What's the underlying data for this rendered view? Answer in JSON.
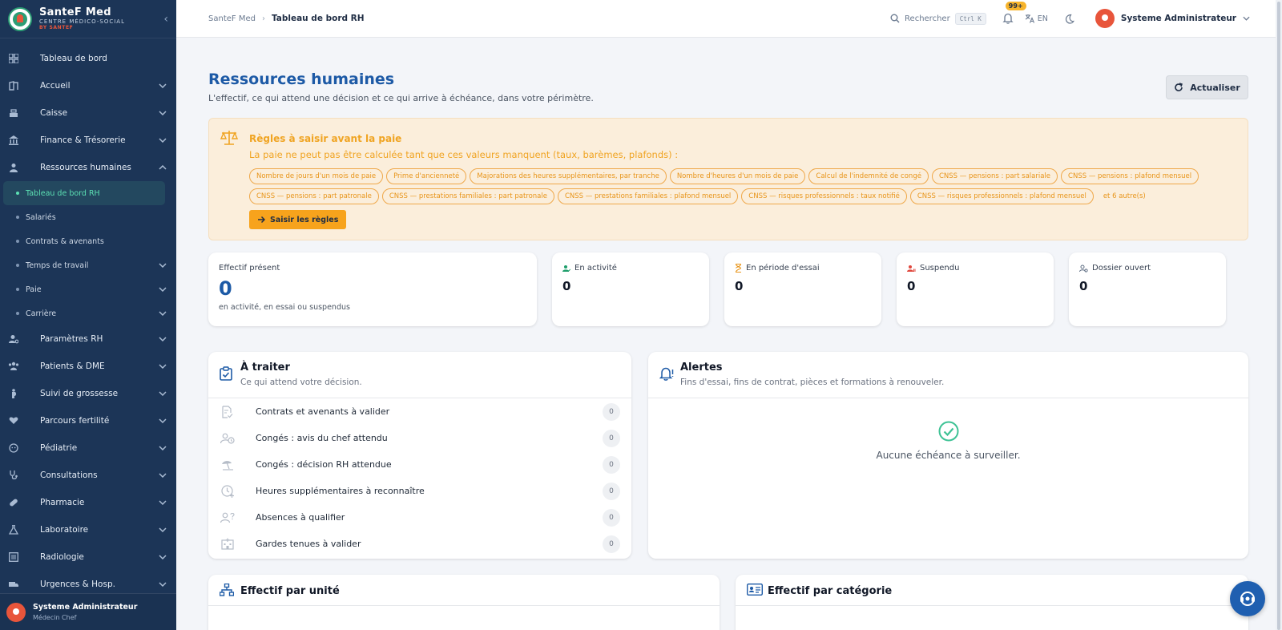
{
  "brand": {
    "name": "SanteF Med",
    "subtitle": "CENTRE MÉDICO-SOCIAL",
    "by": "BY SANTEF"
  },
  "sidebar": {
    "items": [
      {
        "label": "Tableau de bord",
        "icon": "dashboard-icon"
      },
      {
        "label": "Accueil",
        "icon": "door-icon"
      },
      {
        "label": "Caisse",
        "icon": "cash-register-icon"
      },
      {
        "label": "Finance & Trésorerie",
        "icon": "bank-icon"
      },
      {
        "label": "Ressources humaines",
        "icon": "people-icon",
        "expanded": true
      }
    ],
    "hr_sub": [
      {
        "label": "Tableau de bord RH",
        "active": true
      },
      {
        "label": "Salariés"
      },
      {
        "label": "Contrats & avenants"
      },
      {
        "label": "Temps de travail",
        "chevron": true
      },
      {
        "label": "Paie",
        "chevron": true
      },
      {
        "label": "Carrière",
        "chevron": true
      }
    ],
    "more": [
      {
        "label": "Paramètres RH",
        "icon": "user-settings-icon"
      },
      {
        "label": "Patients & DME",
        "icon": "patients-icon"
      },
      {
        "label": "Suivi de grossesse",
        "icon": "pregnancy-icon"
      },
      {
        "label": "Parcours fertilité",
        "icon": "heart-hand-icon"
      },
      {
        "label": "Pédiatrie",
        "icon": "baby-icon"
      },
      {
        "label": "Consultations",
        "icon": "stethoscope-icon"
      },
      {
        "label": "Pharmacie",
        "icon": "pill-icon"
      },
      {
        "label": "Laboratoire",
        "icon": "flask-icon"
      },
      {
        "label": "Radiologie",
        "icon": "xray-icon"
      },
      {
        "label": "Urgences & Hosp.",
        "icon": "ambulance-icon"
      }
    ],
    "user": {
      "name": "Systeme Administrateur",
      "role": "Médecin Chef"
    }
  },
  "topbar": {
    "breadcrumb_root": "SanteF Med",
    "breadcrumb_current": "Tableau de bord RH",
    "search_label": "Rechercher",
    "search_shortcut": "Ctrl K",
    "notif_badge": "99+",
    "lang": "EN",
    "user_name": "Systeme Administrateur"
  },
  "page": {
    "title": "Ressources humaines",
    "subtitle": "L'effectif, ce qui attend une décision et ce qui arrive à échéance, dans votre périmètre.",
    "refresh_label": "Actualiser"
  },
  "payroll_warning": {
    "title": "Règles à saisir avant la paie",
    "text": "La paie ne peut pas être calculée tant que ces valeurs manquent (taux, barèmes, plafonds) :",
    "chips": [
      "Nombre de jours d'un mois de paie",
      "Prime d'ancienneté",
      "Majorations des heures supplémentaires, par tranche",
      "Nombre d'heures d'un mois de paie",
      "Calcul de l'indemnité de congé",
      "CNSS — pensions : part salariale",
      "CNSS — pensions : plafond mensuel",
      "CNSS — pensions : part patronale",
      "CNSS — prestations familiales : part patronale",
      "CNSS — prestations familiales : plafond mensuel",
      "CNSS — risques professionnels : taux notifié",
      "CNSS — risques professionnels : plafond mensuel"
    ],
    "more": "et 6 autre(s)",
    "button": "Saisir les règles",
    "color": "#f0a422"
  },
  "stats": {
    "present": {
      "label": "Effectif présent",
      "value": "0",
      "hint": "en activité, en essai ou suspendus"
    },
    "active": {
      "label": "En activité",
      "value": "0"
    },
    "trial": {
      "label": "En période d'essai",
      "value": "0"
    },
    "suspended": {
      "label": "Suspendu",
      "value": "0"
    },
    "open_file": {
      "label": "Dossier ouvert",
      "value": "0"
    }
  },
  "todo": {
    "title": "À traiter",
    "subtitle": "Ce qui attend votre décision.",
    "rows": [
      {
        "label": "Contrats et avenants à valider",
        "count": "0",
        "icon": "contract-check-icon"
      },
      {
        "label": "Congés : avis du chef attendu",
        "count": "0",
        "icon": "user-clock-icon"
      },
      {
        "label": "Congés : décision RH attendue",
        "count": "0",
        "icon": "beach-umbrella-icon"
      },
      {
        "label": "Heures supplémentaires à reconnaître",
        "count": "0",
        "icon": "clock-plus-icon"
      },
      {
        "label": "Absences à qualifier",
        "count": "0",
        "icon": "user-question-icon"
      },
      {
        "label": "Gardes tenues à valider",
        "count": "0",
        "icon": "hospital-building-icon"
      }
    ]
  },
  "alerts": {
    "title": "Alertes",
    "subtitle": "Fins d'essai, fins de contrat, pièces et formations à renouveler.",
    "empty": "Aucune échéance à surveiller."
  },
  "by_unit": {
    "title": "Effectif par unité"
  },
  "by_category": {
    "title": "Effectif par catégorie"
  },
  "colors": {
    "sidebar": "#1c3557",
    "accent": "#1d5aa6",
    "active_item": "#5ce0b3",
    "avatar": "#e8553b"
  }
}
